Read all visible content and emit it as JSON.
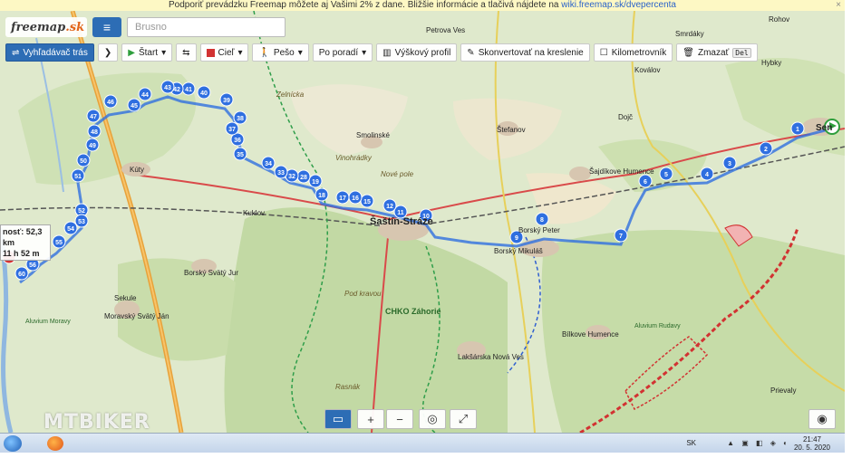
{
  "banner": {
    "text": "Podporiť prevádzku Freemap môžete aj Vašimi 2% z dane. Bližšie informácie a tlačivá nájdete na",
    "link": "wiki.freemap.sk/dvepercenta",
    "close": "×"
  },
  "logo": {
    "text": "freemap",
    "accent": ".sk"
  },
  "search": {
    "value": "Brusno"
  },
  "toolbar": {
    "route_planner": "Vyhľadávač trás",
    "start": "Štart",
    "goal": "Cieľ",
    "mode": "Pešo",
    "order": "Po poradí",
    "elevation": "Výškový profil",
    "convert": "Skonvertovať na kreslenie",
    "milestones": "Kilometrovník",
    "delete": "Zmazať",
    "delete_key": "Del"
  },
  "info": {
    "distance": "nosť: 52,3 km",
    "time": "11 h 52 m"
  },
  "map_labels": {
    "sastin": "Šaštín-Stráže",
    "borsky_peter": "Borský Peter",
    "borsky_mikulas": "Borský Mikuláš",
    "borsky_jur": "Borský Svätý Jur",
    "moravsky_jan": "Moravský Svätý Ján",
    "sekule": "Sekule",
    "kuklov": "Kuklov",
    "kuty": "Kúty",
    "smolinske": "Smolinské",
    "stefanov": "Štefanov",
    "sajdikove": "Šajdíkove Humence",
    "bilkove": "Bílkove Humence",
    "laksarska": "Lakšárska Nová Ves",
    "chko": "CHKO Záhorie",
    "petrova_ves": "Petrova Ves",
    "smrdaky": "Smrdáky",
    "kovalov": "Koválov",
    "hybky": "Hybky",
    "rohov": "Rohov",
    "dojc": "Dojč",
    "senica": "Sen",
    "prievaly": "Prievaly",
    "zelnicka": "Zelnícka",
    "vinohrady": "Vinohrádky",
    "nove_pole": "Nové pole",
    "pod_kravarou": "Pod kravou",
    "rasnak": "Rasnák",
    "aluvium_moravy": "Aluvium Moravy",
    "aluvium_rudavy": "Aluvium Rudavy"
  },
  "waypoints": [
    "1",
    "2",
    "3",
    "4",
    "5",
    "6",
    "7",
    "8",
    "9",
    "10",
    "11",
    "12",
    "15",
    "16",
    "17",
    "18",
    "19",
    "28",
    "32",
    "33",
    "34",
    "35",
    "36",
    "37",
    "38",
    "39",
    "40",
    "41",
    "42",
    "43",
    "44",
    "45",
    "46",
    "47",
    "48",
    "49",
    "50",
    "51",
    "52",
    "53",
    "54",
    "55",
    "56",
    "60",
    "63",
    "64",
    "65"
  ],
  "controls": {
    "layers": "▭",
    "zoom_in": "+",
    "zoom_out": "−",
    "locate": "◎",
    "fullscreen": "⤢",
    "settings": "◉"
  },
  "watermark": "MTBIKER",
  "taskbar": {
    "lang": "SK",
    "time": "21:47",
    "date": "20. 5. 2020"
  }
}
